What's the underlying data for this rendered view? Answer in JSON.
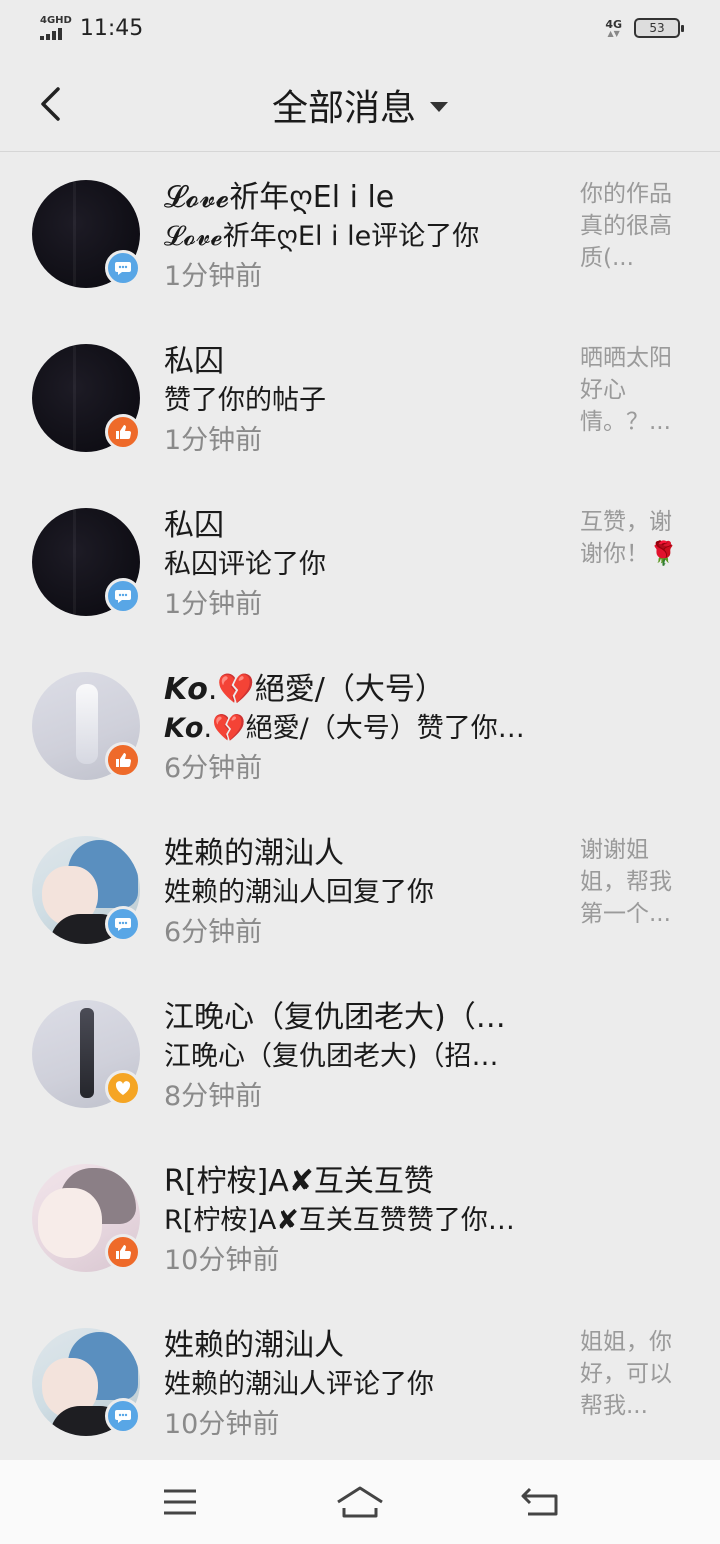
{
  "status_bar": {
    "network_left": "4GHD",
    "time": "11:45",
    "network_right": "4G",
    "network_right_arrows": "▲▼",
    "battery": "53"
  },
  "header": {
    "title": "全部消息"
  },
  "messages": [
    {
      "name": "𝓛𝓸𝓿𝓮祈年ღEl i le",
      "action": "𝓛𝓸𝓿𝓮祈年ღEl i le评论了你",
      "time": "1分钟前",
      "preview": "你的作品真的很高质(...",
      "badge": "comment-icon",
      "avatar": "dark"
    },
    {
      "name": "私囚",
      "action": "赞了你的帖子",
      "time": "1分钟前",
      "preview": "晒晒太阳好心情。？...",
      "badge": "like-icon",
      "avatar": "dark"
    },
    {
      "name": "私囚",
      "action": "私囚评论了你",
      "time": "1分钟前",
      "preview": "互赞，谢谢你！🌹",
      "badge": "comment-icon",
      "avatar": "dark"
    },
    {
      "name": "𝙆𝙤.💔絕愛/（大号）",
      "action": "𝙆𝙤.💔絕愛/（大号）赞了你…",
      "time": "6分钟前",
      "preview": "",
      "badge": "like-icon",
      "avatar": "light"
    },
    {
      "name": "姓赖的潮汕人",
      "action": "姓赖的潮汕人回复了你",
      "time": "6分钟前",
      "preview": "谢谢姐姐，帮我第一个...",
      "badge": "comment-icon",
      "avatar": "anime"
    },
    {
      "name": "江晚心（复仇团老大)（…",
      "action": "江晚心（复仇团老大)（招…",
      "time": "8分钟前",
      "preview": "",
      "badge": "heart-icon",
      "avatar": "light2"
    },
    {
      "name": "R[柠桉]A✘互关互赞",
      "action": "R[柠桉]A✘互关互赞赞了你…",
      "time": "10分钟前",
      "preview": "",
      "badge": "like-icon",
      "avatar": "anime2"
    },
    {
      "name": "姓赖的潮汕人",
      "action": "姓赖的潮汕人评论了你",
      "time": "10分钟前",
      "preview": "姐姐，你好，可以帮我...",
      "badge": "comment-icon",
      "avatar": "anime"
    }
  ],
  "nav": {
    "menu_icon": "menu-icon",
    "home_icon": "home-icon",
    "back_icon": "back-icon"
  },
  "colors": {
    "background": "#ececec",
    "comment_badge": "#58a6e6",
    "like_badge": "#ee6a2a",
    "heart_badge": "#f5a524"
  }
}
